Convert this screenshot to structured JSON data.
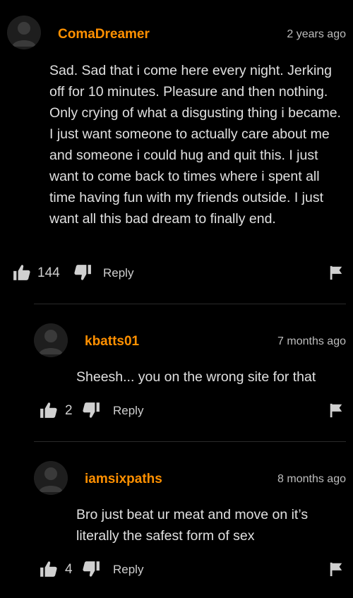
{
  "comments": [
    {
      "username": "ComaDreamer",
      "time": "2 years ago",
      "text": "Sad. Sad that i come here every night. Jerking off for 10 minutes. Pleasure and then nothing. Only crying of what a disgusting thing i became. I just want someone to actually care about me and someone i could hug and quit this. I just want to come back to times where i spent all time having fun with my friends outside. I just want all this bad dream to finally end.",
      "likes": "144",
      "reply_label": "Reply"
    },
    {
      "username": "kbatts01",
      "time": "7 months ago",
      "text": "Sheesh... you on the wrong site for that",
      "likes": "2",
      "reply_label": "Reply"
    },
    {
      "username": "iamsixpaths",
      "time": "8 months ago",
      "text": "Bro just beat ur meat and move on it’s literally the safest form of sex",
      "likes": "4",
      "reply_label": "Reply"
    }
  ],
  "icons": {
    "avatar": "default-user-avatar-icon",
    "like": "thumbs-up-icon",
    "dislike": "thumbs-down-icon",
    "report": "flag-icon"
  },
  "colors": {
    "background": "#000000",
    "username": "#ff9000",
    "text": "#e0e0e0",
    "muted": "#bdbdbd"
  }
}
